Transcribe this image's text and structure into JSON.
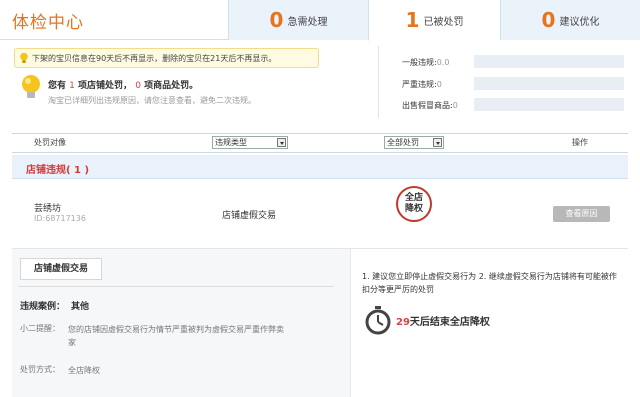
{
  "header": {
    "title": "体检中心",
    "tabs": [
      {
        "num": "0",
        "label": "急需处理"
      },
      {
        "num": "1",
        "label": "已被处罚"
      },
      {
        "num": "0",
        "label": "建议优化"
      }
    ]
  },
  "notice": {
    "text": "下架的宝贝信息在90天后不再显示，删除的宝贝在21天后不再显示。"
  },
  "summary": {
    "prefix": "您有",
    "shop_count": "1",
    "mid": "项店铺处罚，",
    "goods_count": "0",
    "suffix": "项商品处罚。",
    "tip": "淘宝已详细列出违规原因，请您注意查看，避免二次违规。"
  },
  "stats": [
    {
      "label": "一般违规:",
      "value": "0.0"
    },
    {
      "label": "严重违规:",
      "value": "0"
    },
    {
      "label": "出售假冒商品:",
      "value": "0"
    }
  ],
  "filters": {
    "col_object": "处罚对像",
    "type_select": "违规类型",
    "penalty_select": "全部处罚",
    "col_action": "操作"
  },
  "section": {
    "title": "店铺违规( 1 )"
  },
  "row": {
    "shop_name": "芸绣坊",
    "shop_id": "ID:68717136",
    "violation_type": "店铺虚假交易",
    "stamp_line1": "全店",
    "stamp_line2": "降权",
    "view_button": "查看原因"
  },
  "detail": {
    "tab_label": "店铺虚假交易",
    "case_label": "违规案例：",
    "case_value": "其他",
    "reminder_label": "小二提醒：",
    "reminder_value": "您的店铺因虚假交易行为情节严重被判为虚假交易严重作弊卖家",
    "method_label": "处罚方式：",
    "method_value": "全店降权",
    "suggestion": "1. 建议您立即停止虚假交易行为 2. 继续虚假交易行为店铺将有可能被作扣分等更严厉的处罚",
    "countdown_days": "29",
    "countdown_text": "天后结束全店降权"
  },
  "colors": {
    "accent": "#e6741d",
    "alert": "#d23a3a",
    "tab_bg": "#eaf2fa"
  }
}
